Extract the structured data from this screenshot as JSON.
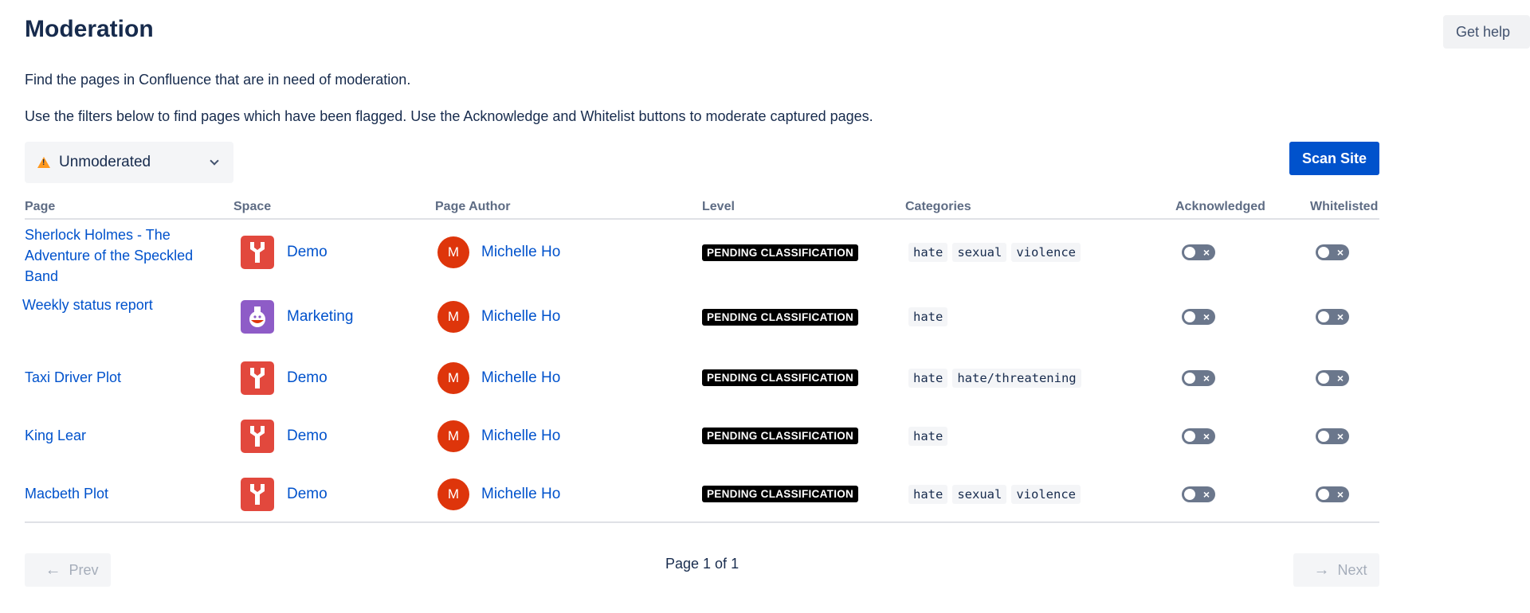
{
  "header": {
    "title": "Moderation",
    "help_label": "Get help"
  },
  "description": {
    "line1": "Find the pages in Confluence that are in need of moderation.",
    "line2": "Use the filters below to find pages which have been flagged. Use the Acknowledge and Whitelist buttons to moderate captured pages."
  },
  "filter": {
    "selected": "Unmoderated",
    "icon": "warning-icon"
  },
  "scan_label": "Scan Site",
  "table": {
    "columns": [
      "Page",
      "Space",
      "Page Author",
      "Level",
      "Categories",
      "Acknowledged",
      "Whitelisted"
    ],
    "rows": [
      {
        "page_lines": [
          "Sherlock Holmes - The",
          "Adventure of the Speckled",
          "Band"
        ],
        "space": "Demo",
        "space_icon": "wrench-icon",
        "author_initial": "M",
        "author": "Michelle Ho",
        "level": "PENDING CLASSIFICATION",
        "categories": [
          "hate",
          "sexual",
          "violence"
        ],
        "acknowledged": false,
        "whitelisted": false
      },
      {
        "page_lines": [
          "Weekly status report"
        ],
        "space": "Marketing",
        "space_icon": "flask-icon",
        "author_initial": "M",
        "author": "Michelle Ho",
        "level": "PENDING CLASSIFICATION",
        "categories": [
          "hate"
        ],
        "acknowledged": false,
        "whitelisted": false
      },
      {
        "page_lines": [
          "Taxi Driver Plot"
        ],
        "space": "Demo",
        "space_icon": "wrench-icon",
        "author_initial": "M",
        "author": "Michelle Ho",
        "level": "PENDING CLASSIFICATION",
        "categories": [
          "hate",
          "hate/threatening"
        ],
        "acknowledged": false,
        "whitelisted": false
      },
      {
        "page_lines": [
          "King Lear"
        ],
        "space": "Demo",
        "space_icon": "wrench-icon",
        "author_initial": "M",
        "author": "Michelle Ho",
        "level": "PENDING CLASSIFICATION",
        "categories": [
          "hate"
        ],
        "acknowledged": false,
        "whitelisted": false
      },
      {
        "page_lines": [
          "Macbeth Plot"
        ],
        "space": "Demo",
        "space_icon": "wrench-icon",
        "author_initial": "M",
        "author": "Michelle Ho",
        "level": "PENDING CLASSIFICATION",
        "categories": [
          "hate",
          "sexual",
          "violence"
        ],
        "acknowledged": false,
        "whitelisted": false
      }
    ]
  },
  "pagination": {
    "prev_label": "Prev",
    "next_label": "Next",
    "info": "Page 1 of 1"
  },
  "colors": {
    "primary": "#0052cc",
    "danger": "#de350b",
    "warning": "#ff991f",
    "demo_space": "#e2483d",
    "marketing_space": "#8e5cc7"
  }
}
